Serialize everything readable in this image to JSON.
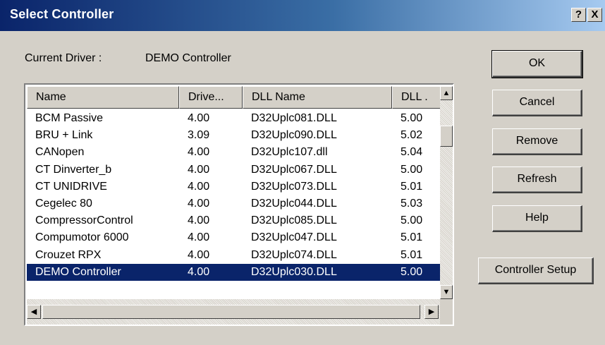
{
  "window": {
    "title": "Select Controller",
    "help_button": "?",
    "close_button": "X"
  },
  "current_driver": {
    "label": "Current Driver :",
    "value": "DEMO Controller"
  },
  "list": {
    "columns": [
      "Name",
      "Drive...",
      "DLL Name",
      "DLL ."
    ],
    "rows": [
      {
        "name": "BCM Passive",
        "driver": "4.00",
        "dll_name": "D32Uplc081.DLL",
        "dll_ver": "5.00"
      },
      {
        "name": "BRU + Link",
        "driver": "3.09",
        "dll_name": "D32Uplc090.DLL",
        "dll_ver": "5.02"
      },
      {
        "name": "CANopen",
        "driver": "4.00",
        "dll_name": "D32Uplc107.dll",
        "dll_ver": "5.04"
      },
      {
        "name": "CT Dinverter_b",
        "driver": "4.00",
        "dll_name": "D32Uplc067.DLL",
        "dll_ver": "5.00"
      },
      {
        "name": "CT UNIDRIVE",
        "driver": "4.00",
        "dll_name": "D32Uplc073.DLL",
        "dll_ver": "5.01"
      },
      {
        "name": "Cegelec 80",
        "driver": "4.00",
        "dll_name": "D32Uplc044.DLL",
        "dll_ver": "5.03"
      },
      {
        "name": "CompressorControl",
        "driver": "4.00",
        "dll_name": "D32Uplc085.DLL",
        "dll_ver": "5.00"
      },
      {
        "name": "Compumotor 6000",
        "driver": "4.00",
        "dll_name": "D32Uplc047.DLL",
        "dll_ver": "5.01"
      },
      {
        "name": "Crouzet RPX",
        "driver": "4.00",
        "dll_name": "D32Uplc074.DLL",
        "dll_ver": "5.01"
      },
      {
        "name": "DEMO Controller",
        "driver": "4.00",
        "dll_name": "D32Uplc030.DLL",
        "dll_ver": "5.00",
        "selected": true
      }
    ]
  },
  "buttons": {
    "ok": "OK",
    "cancel": "Cancel",
    "remove": "Remove",
    "refresh": "Refresh",
    "help": "Help",
    "controller_setup": "Controller Setup"
  },
  "colors": {
    "title_gradient_start": "#0a246a",
    "title_gradient_end": "#a6caf0",
    "selection": "#0a246a",
    "face": "#d4d0c8"
  }
}
